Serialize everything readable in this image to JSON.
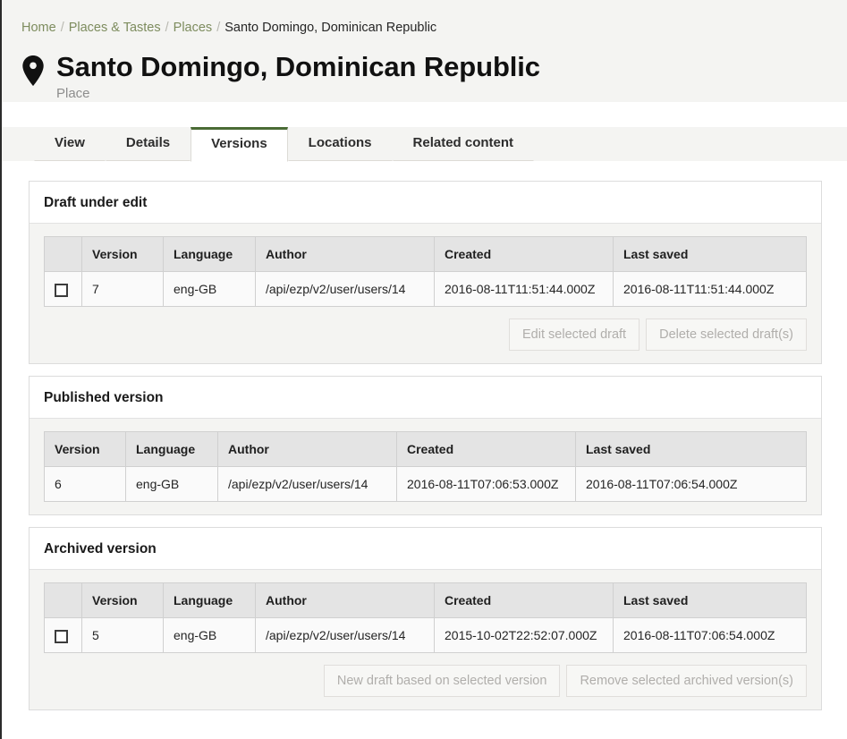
{
  "breadcrumb": {
    "items": [
      {
        "label": "Home",
        "current": false
      },
      {
        "label": "Places & Tastes",
        "current": false
      },
      {
        "label": "Places",
        "current": false
      },
      {
        "label": "Santo Domingo, Dominican Republic",
        "current": true
      }
    ],
    "separator": "/"
  },
  "header": {
    "icon": "map-pin-icon",
    "title": "Santo Domingo, Dominican Republic",
    "subtitle": "Place"
  },
  "tabs": [
    {
      "label": "View",
      "active": false
    },
    {
      "label": "Details",
      "active": false
    },
    {
      "label": "Versions",
      "active": true
    },
    {
      "label": "Locations",
      "active": false
    },
    {
      "label": "Related content",
      "active": false
    }
  ],
  "columns": {
    "version": "Version",
    "language": "Language",
    "author": "Author",
    "created": "Created",
    "last_saved": "Last saved"
  },
  "panels": {
    "draft": {
      "title": "Draft under edit",
      "has_checkbox": true,
      "rows": [
        {
          "version": "7",
          "language": "eng-GB",
          "author": "/api/ezp/v2/user/users/14",
          "created": "2016-08-11T11:51:44.000Z",
          "last_saved": "2016-08-11T11:51:44.000Z"
        }
      ],
      "actions": [
        {
          "label": "Edit selected draft",
          "disabled": true
        },
        {
          "label": "Delete selected draft(s)",
          "disabled": true
        }
      ]
    },
    "published": {
      "title": "Published version",
      "has_checkbox": false,
      "rows": [
        {
          "version": "6",
          "language": "eng-GB",
          "author": "/api/ezp/v2/user/users/14",
          "created": "2016-08-11T07:06:53.000Z",
          "last_saved": "2016-08-11T07:06:54.000Z"
        }
      ],
      "actions": []
    },
    "archived": {
      "title": "Archived version",
      "has_checkbox": true,
      "rows": [
        {
          "version": "5",
          "language": "eng-GB",
          "author": "/api/ezp/v2/user/users/14",
          "created": "2015-10-02T22:52:07.000Z",
          "last_saved": "2016-08-11T07:06:54.000Z"
        }
      ],
      "actions": [
        {
          "label": "New draft based on selected version",
          "disabled": true
        },
        {
          "label": "Remove selected archived version(s)",
          "disabled": true
        }
      ]
    }
  },
  "colors": {
    "accent_green": "#4a6b35",
    "link_green": "#7d8c5e",
    "header_bg": "#f4f4f2",
    "table_header_bg": "#e4e4e4"
  }
}
